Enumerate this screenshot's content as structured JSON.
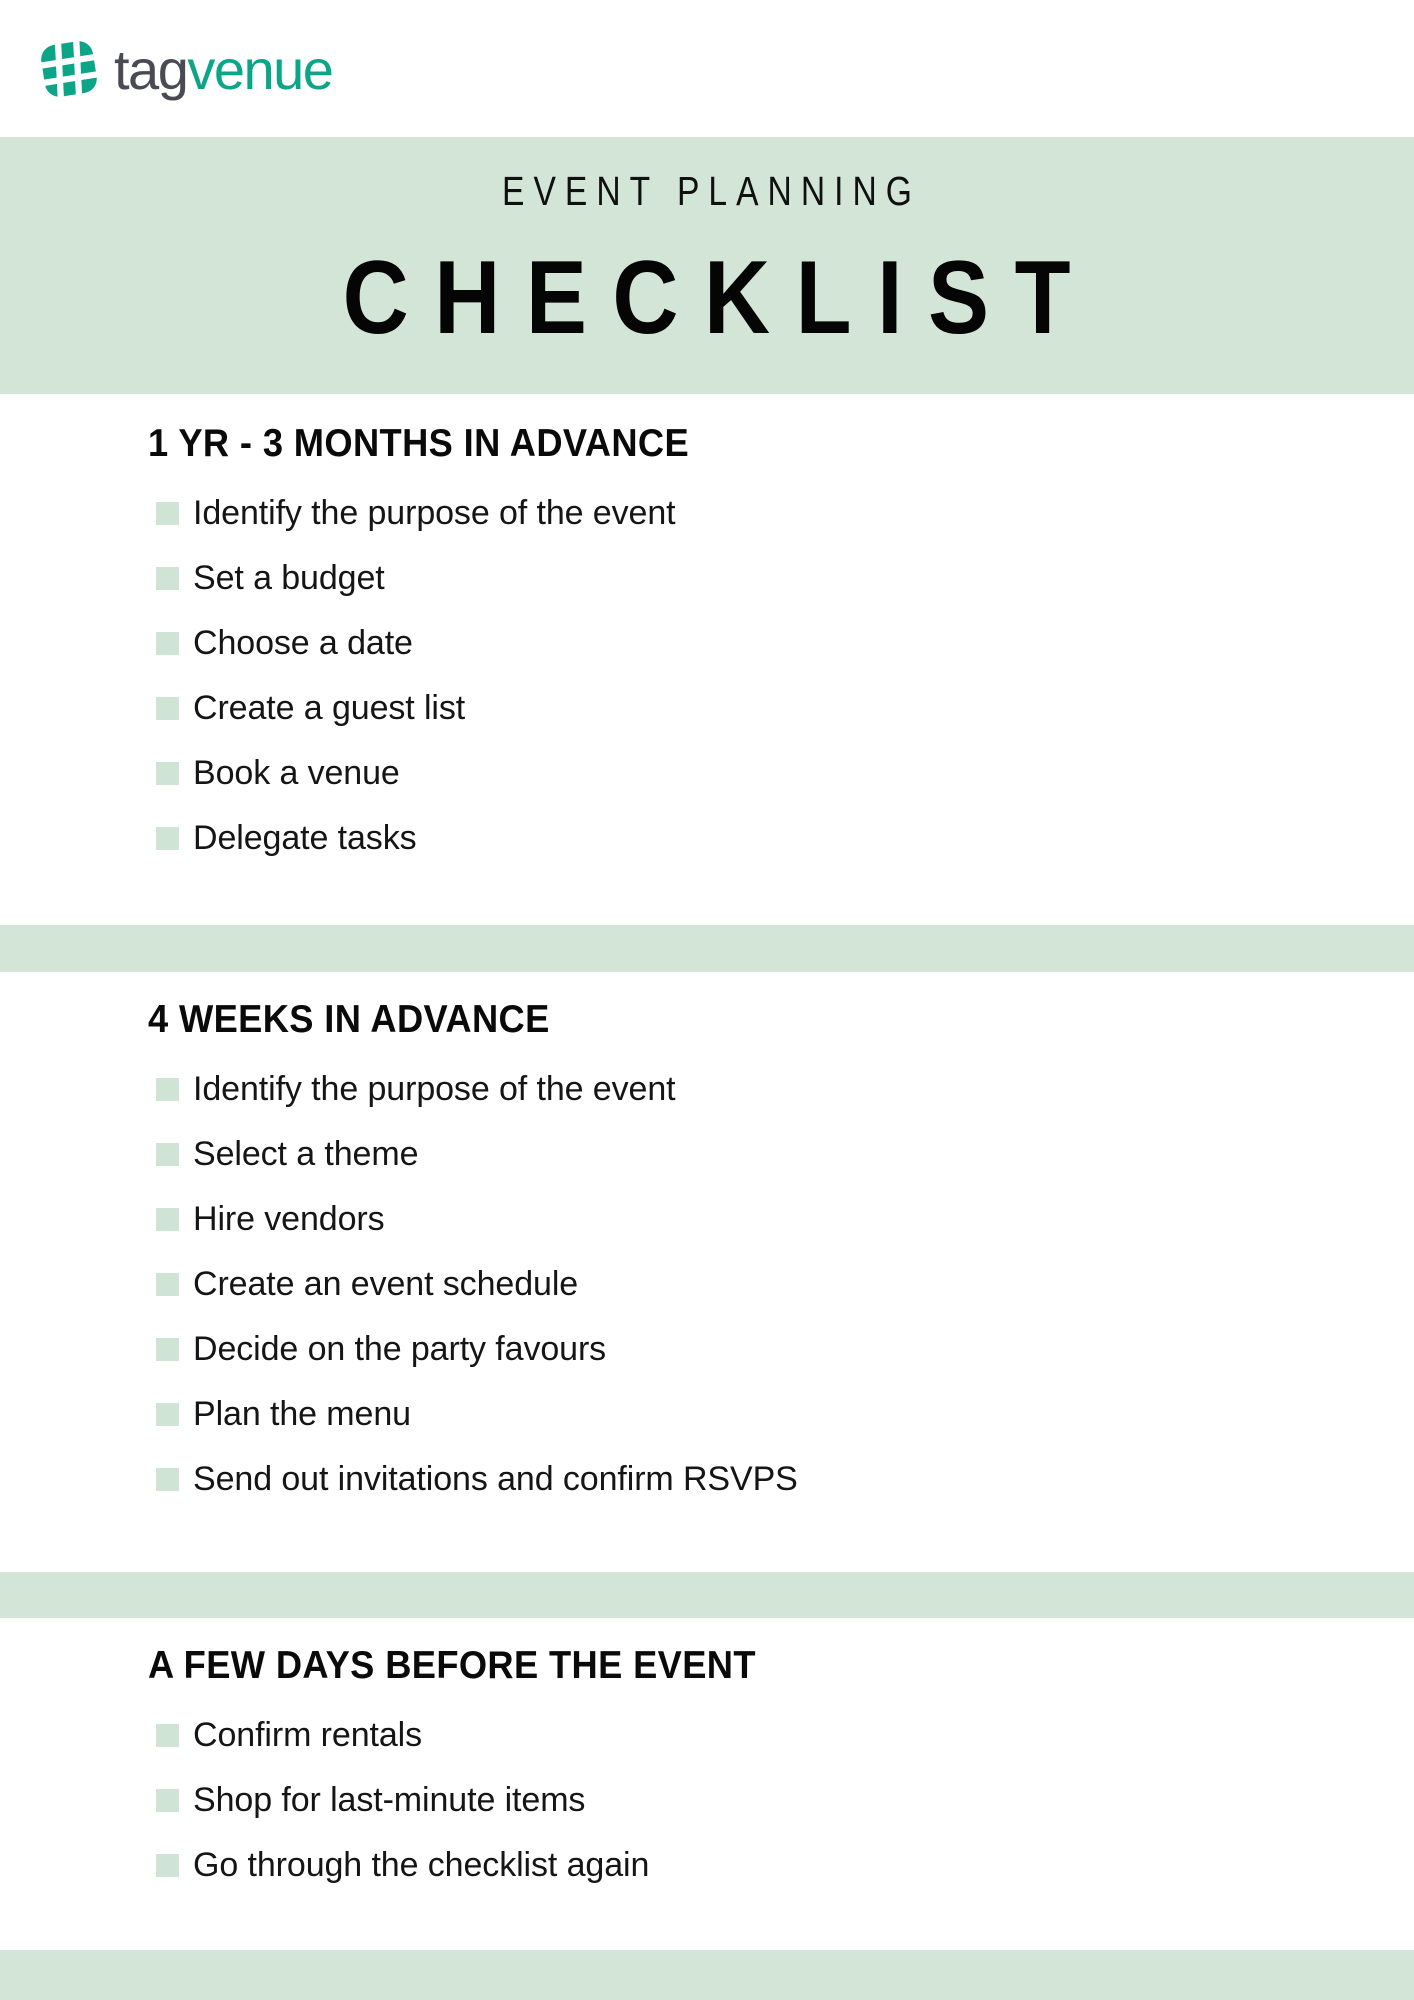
{
  "brand": {
    "logo_icon": "tagvenue-hash-logo",
    "name_part_1": "tag",
    "name_part_2": "venue",
    "mark_color": "#0DA587",
    "word_color_1": "#4A4A55",
    "word_color_2": "#0DA587"
  },
  "header": {
    "eyebrow": "EVENT PLANNING",
    "title": "CHECKLIST",
    "band_color": "#D3E5D7"
  },
  "theme": {
    "band_color": "#D3E5D7",
    "checkbox_color": "#D0E4D5",
    "text_color": "#151515",
    "page_background": "#FFFFFF"
  },
  "sections": [
    {
      "title": "1 YR - 3 MONTHS IN ADVANCE",
      "items": [
        "Identify the purpose of the event",
        "Set a budget",
        "Choose a date",
        "Create a guest list",
        "Book a venue",
        "Delegate tasks"
      ]
    },
    {
      "title": "4 WEEKS IN ADVANCE",
      "items": [
        "Identify the purpose of the event",
        "Select a theme",
        "Hire vendors",
        "Create an event schedule",
        "Decide on the party favours",
        "Plan the menu",
        "Send out invitations and confirm RSVPS"
      ]
    },
    {
      "title": "A FEW DAYS BEFORE THE EVENT",
      "items": [
        "Confirm rentals",
        "Shop for last-minute items",
        "Go through the checklist again"
      ]
    }
  ]
}
